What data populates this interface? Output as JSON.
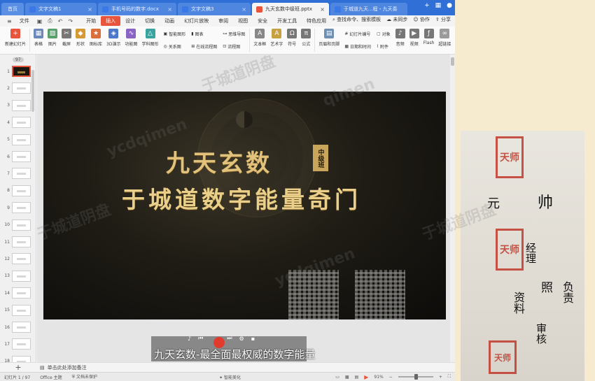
{
  "tabs": [
    {
      "label": "首页",
      "type": "home"
    },
    {
      "label": "文字文稿1",
      "icon_color": "#3b78e7"
    },
    {
      "label": "手机号码的数字.docx",
      "icon_color": "#3b78e7"
    },
    {
      "label": "文字文稿3",
      "icon_color": "#3b78e7"
    },
    {
      "label": "九天玄数中级班.pptx",
      "icon_color": "#e8553c",
      "active": true
    },
    {
      "label": "于城道九天...程・九天奏",
      "icon_color": "#3b78e7"
    }
  ],
  "menu": {
    "file": "文件",
    "items": [
      "开始",
      "插入",
      "设计",
      "切换",
      "动画",
      "幻灯片放映",
      "审阅",
      "视图",
      "安全",
      "开发工具",
      "特色应用"
    ],
    "active": "插入",
    "search": "查找命令、搜索模板",
    "sync": "未同步",
    "collab": "协作",
    "share": "分享"
  },
  "ribbon": {
    "new_slide": "新建幻灯片",
    "table": "表格",
    "picture": "图片",
    "screenshot": "截屏",
    "shape": "形状",
    "icon_lib": "图标库",
    "threed": "3D演示",
    "funcchart": "功能图",
    "subject_chart": "学科图形",
    "smart_shape": "智能图形",
    "relation": "关系图",
    "chart": "图表",
    "online_flow": "在线流程图",
    "mind_map": "思维导图",
    "flowchart": "流程图",
    "textbox": "文本框",
    "art_text": "艺术字",
    "symbol": "符号",
    "formula": "公式",
    "header_footer": "页眉和页脚",
    "slide_number": "幻灯片编号",
    "object": "对象",
    "datetime": "日期和时间",
    "attachment": "附件",
    "audio": "音频",
    "video": "视频",
    "flash": "Flash",
    "hyperlink": "超链接"
  },
  "thumbs": {
    "count_badge": "97",
    "numbers": [
      "1",
      "2",
      "3",
      "4",
      "5",
      "6",
      "7",
      "8",
      "9",
      "10",
      "11",
      "12",
      "13",
      "14",
      "15",
      "16",
      "17",
      "18"
    ]
  },
  "slide": {
    "title": "九天玄数",
    "badge": "中级班",
    "subtitle": "于城道数字能量奇门"
  },
  "player": {
    "subtitle": "九天玄数-最全面最权威的数字能量"
  },
  "notes": {
    "placeholder": "单击此处添加备注"
  },
  "status": {
    "slide_info": "幻灯片 1 / 97",
    "theme": "Office 主题",
    "protect": "文档未保护",
    "smart_beautify": "智能美化",
    "zoom": "91%",
    "zoom_level": 0.52
  },
  "watermarks": [
    "于城道阴盘",
    "ycdqimen",
    "于城道阴盘",
    "ycdqimen",
    "于城道阴盘",
    "qimen"
  ],
  "photo": {
    "seal_top": "天师",
    "seal_mid": "天师",
    "seal_bottom": "天师",
    "ink_text": [
      "元",
      "帅",
      "经理",
      "照",
      "资料",
      "负责",
      "审核"
    ]
  },
  "colors": {
    "title_bar": "#2f6fd6",
    "accent": "#e8553c",
    "slide_gold": "#e2c27a"
  }
}
